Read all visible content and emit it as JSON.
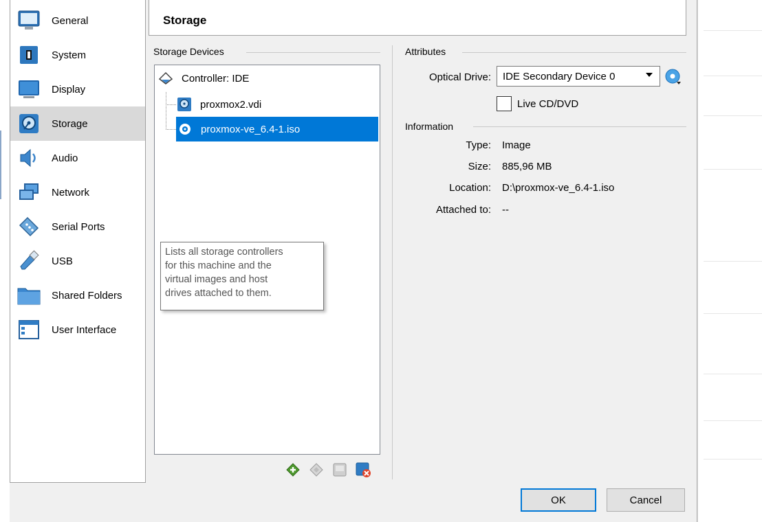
{
  "header": {
    "title": "Storage"
  },
  "sidebar": {
    "items": [
      {
        "label": "General",
        "icon": "general-icon"
      },
      {
        "label": "System",
        "icon": "system-icon"
      },
      {
        "label": "Display",
        "icon": "display-icon"
      },
      {
        "label": "Storage",
        "icon": "storage-icon",
        "selected": true
      },
      {
        "label": "Audio",
        "icon": "audio-icon"
      },
      {
        "label": "Network",
        "icon": "network-icon"
      },
      {
        "label": "Serial Ports",
        "icon": "serial-ports-icon"
      },
      {
        "label": "USB",
        "icon": "usb-icon"
      },
      {
        "label": "Shared Folders",
        "icon": "shared-folders-icon"
      },
      {
        "label": "User Interface",
        "icon": "user-interface-icon"
      }
    ]
  },
  "storage_devices": {
    "title": "Storage Devices",
    "controller": "Controller: IDE",
    "items": [
      {
        "label": "proxmox2.vdi",
        "icon": "hard-disk-icon"
      },
      {
        "label": "proxmox-ve_6.4-1.iso",
        "icon": "optical-disc-icon",
        "selected": true
      }
    ],
    "tooltip": [
      "Lists all storage controllers",
      "for this machine and the",
      "virtual images and host",
      "drives attached to them."
    ]
  },
  "attributes": {
    "title": "Attributes",
    "optical_drive_label": "Optical Drive:",
    "optical_drive_value": "IDE Secondary Device 0",
    "live_cd_label": "Live CD/DVD",
    "live_cd_checked": false
  },
  "information": {
    "title": "Information",
    "type_label": "Type:",
    "type_value": "Image",
    "size_label": "Size:",
    "size_value": "885,96 MB",
    "location_label": "Location:",
    "location_value": "D:\\proxmox-ve_6.4-1.iso",
    "attached_label": "Attached to:",
    "attached_value": "--"
  },
  "buttons": {
    "ok": "OK",
    "cancel": "Cancel"
  },
  "colors": {
    "selection": "#0078d7",
    "sidebar_selected": "#d9d9d9",
    "dialog_bg": "#f0f0f0"
  }
}
